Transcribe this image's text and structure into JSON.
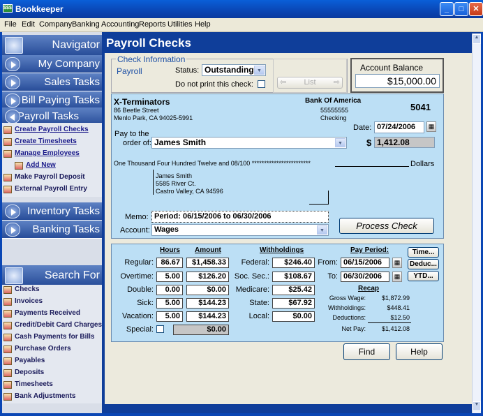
{
  "window": {
    "title": "Bookkeeper",
    "app_icon": "$$$"
  },
  "menu": [
    "File",
    "Edit",
    "Company",
    "Banking",
    "Accounting",
    "Reports",
    "Utilities",
    "Help"
  ],
  "navigator": {
    "header": "Navigator",
    "sections": [
      "My Company",
      "Sales Tasks",
      "Bill Paying Tasks",
      "Payroll Tasks"
    ],
    "payroll_items": [
      "Create Payroll Checks",
      "Create Timesheets",
      "Manage Employees",
      "Add New",
      "Make Payroll Deposit",
      "External Payroll Entry"
    ],
    "lower_sections": [
      "Inventory Tasks",
      "Banking Tasks"
    ],
    "search_header": "Search For",
    "search_items": [
      "Checks",
      "Invoices",
      "Payments Received",
      "Credit/Debit Card Charges",
      "Cash Payments for Bills",
      "Purchase Orders",
      "Payables",
      "Deposits",
      "Timesheets",
      "Bank Adjustments"
    ]
  },
  "page": {
    "title": "Payroll Checks"
  },
  "check_info": {
    "group_label": "Check Information",
    "type": "Payroll",
    "status_label": "Status:",
    "status_value": "Outstanding",
    "do_not_print_label": "Do not print this check:",
    "list_label": "List",
    "account_balance_label": "Account Balance",
    "account_balance_value": "$15,000.00"
  },
  "check": {
    "company_name": "X-Terminators",
    "company_street": "86 Beetle Street",
    "company_city": "Menlo Park, CA 94025-5991",
    "bank_name": "Bank Of America",
    "bank_number": "55555555",
    "bank_account_type": "Checking",
    "check_number": "5041",
    "date_label": "Date:",
    "date_value": "07/24/2006",
    "pay_to_label_1": "Pay to the",
    "pay_to_label_2": "order of:",
    "payee": "James Smith",
    "currency_symbol": "$",
    "amount": "1,412.08",
    "amount_words": "One Thousand Four Hundred Twelve and 08/100 ************************",
    "dollars_label": "Dollars",
    "address_name": "James Smith",
    "address_street": "5585 River Ct.",
    "address_city": "Castro Valley, CA 94596",
    "memo_label": "Memo:",
    "memo_value": "Period: 06/15/2006 to 06/30/2006",
    "account_label": "Account:",
    "account_value": "Wages",
    "process_button": "Process Check"
  },
  "payroll": {
    "hours_header": "Hours",
    "amount_header": "Amount",
    "withholdings_header": "Withholdings",
    "pay_period_header": "Pay Period:",
    "rows": [
      {
        "label": "Regular:",
        "hours": "86.67",
        "amount": "$1,458.33"
      },
      {
        "label": "Overtime:",
        "hours": "5.00",
        "amount": "$126.20"
      },
      {
        "label": "Double:",
        "hours": "0.00",
        "amount": "$0.00"
      },
      {
        "label": "Sick:",
        "hours": "5.00",
        "amount": "$144.23"
      },
      {
        "label": "Vacation:",
        "hours": "5.00",
        "amount": "$144.23"
      }
    ],
    "special_label": "Special:",
    "special_amount": "$0.00",
    "withholdings": [
      {
        "label": "Federal:",
        "value": "$246.40"
      },
      {
        "label": "Soc. Sec.:",
        "value": "$108.67"
      },
      {
        "label": "Medicare:",
        "value": "$25.42"
      },
      {
        "label": "State:",
        "value": "$67.92"
      },
      {
        "label": "Local:",
        "value": "$0.00"
      }
    ],
    "from_label": "From:",
    "from_value": "06/15/2006",
    "to_label": "To:",
    "to_value": "06/30/2006",
    "recap_header": "Recap",
    "recap": [
      {
        "label": "Gross Wage:",
        "value": "$1,872.99"
      },
      {
        "label": "Withholdings:",
        "value": "$448.41"
      },
      {
        "label": "Deductions:",
        "value": "$12.50"
      },
      {
        "label": "Net Pay:",
        "value": "$1,412.08"
      }
    ],
    "time_button": "Time...",
    "deduc_button": "Deduc...",
    "ytd_button": "YTD..."
  },
  "footer": {
    "find_button": "Find",
    "help_button": "Help"
  }
}
